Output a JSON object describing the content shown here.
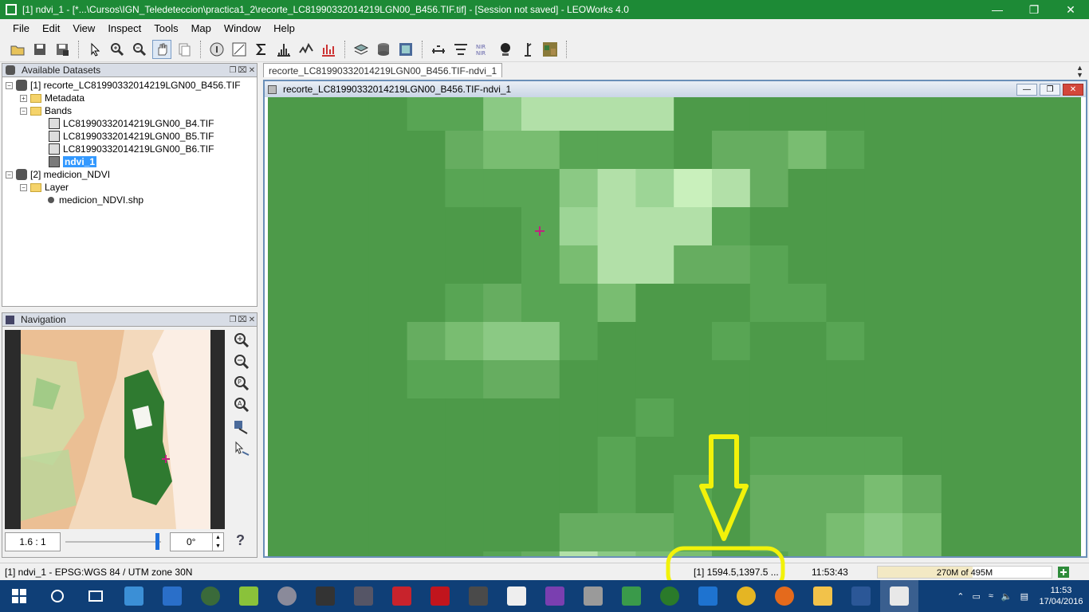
{
  "window": {
    "title": "[1] ndvi_1 - [*...\\Cursos\\IGN_Teledeteccion\\practica1_2\\recorte_LC81990332014219LGN00_B456.TIF.tif] - [Session not saved] - LEOWorks 4.0"
  },
  "menu": [
    "File",
    "Edit",
    "View",
    "Inspect",
    "Tools",
    "Map",
    "Window",
    "Help"
  ],
  "datasets_panel": {
    "title": "Available Datasets",
    "items": [
      {
        "label": "[1] recorte_LC81990332014219LGN00_B456.TIF"
      },
      {
        "label": "Metadata"
      },
      {
        "label": "Bands"
      },
      {
        "label": "LC81990332014219LGN00_B4.TIF"
      },
      {
        "label": "LC81990332014219LGN00_B5.TIF"
      },
      {
        "label": "LC81990332014219LGN00_B6.TIF"
      },
      {
        "label": "ndvi_1"
      },
      {
        "label": "[2] medicion_NDVI"
      },
      {
        "label": "Layer"
      },
      {
        "label": "medicion_NDVI.shp"
      }
    ]
  },
  "navigation_panel": {
    "title": "Navigation",
    "scale": "1.6 : 1",
    "rotation": "0°",
    "help": "?"
  },
  "document": {
    "tab_label": "recorte_LC81990332014219LGN00_B456.TIF-ndvi_1",
    "frame_title": "recorte_LC81990332014219LGN00_B456.TIF-ndvi_1"
  },
  "status": {
    "crs": "[1] ndvi_1 - EPSG:WGS 84 / UTM zone 30N",
    "coords": "[1] 1594.5,1397.5 ...",
    "time": "11:53:43",
    "memory": "270M of 495M",
    "memory_fraction": 0.545
  },
  "taskbar": {
    "time": "11:53",
    "date": "17/04/2016"
  },
  "colors": {
    "titlebar": "#1d8a36",
    "annotation": "#f2f20a"
  }
}
